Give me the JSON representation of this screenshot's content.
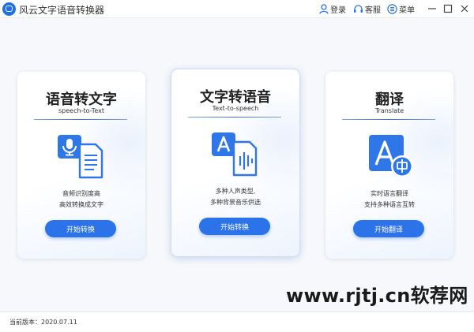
{
  "app": {
    "title": "风云文字语音转换器"
  },
  "titlebar": {
    "login_label": "登录",
    "service_label": "客服",
    "menu_label": "菜单"
  },
  "colors": {
    "accent": "#2c72e8",
    "icon_blue": "#2f77e8"
  },
  "cards": [
    {
      "title": "语音转文字",
      "subtitle": "speech-to-Text",
      "desc1": "音频识别度高",
      "desc2": "高效转换成文字",
      "button": "开始转换",
      "icon": "mic-to-doc-icon"
    },
    {
      "title": "文字转语音",
      "subtitle": "Text-to-speech",
      "desc1": "多种人声类型,",
      "desc2": "多种背景音乐供选",
      "button": "开始转换",
      "icon": "text-to-audio-icon"
    },
    {
      "title": "翻译",
      "subtitle": "Translate",
      "desc1": "实时语言翻译",
      "desc2": "支持多种语言互转",
      "button": "开始翻译",
      "icon": "translate-icon"
    }
  ],
  "watermark": "www.rjtj.cn软荐网",
  "footer": {
    "version": "当前版本：2020.07.11"
  }
}
